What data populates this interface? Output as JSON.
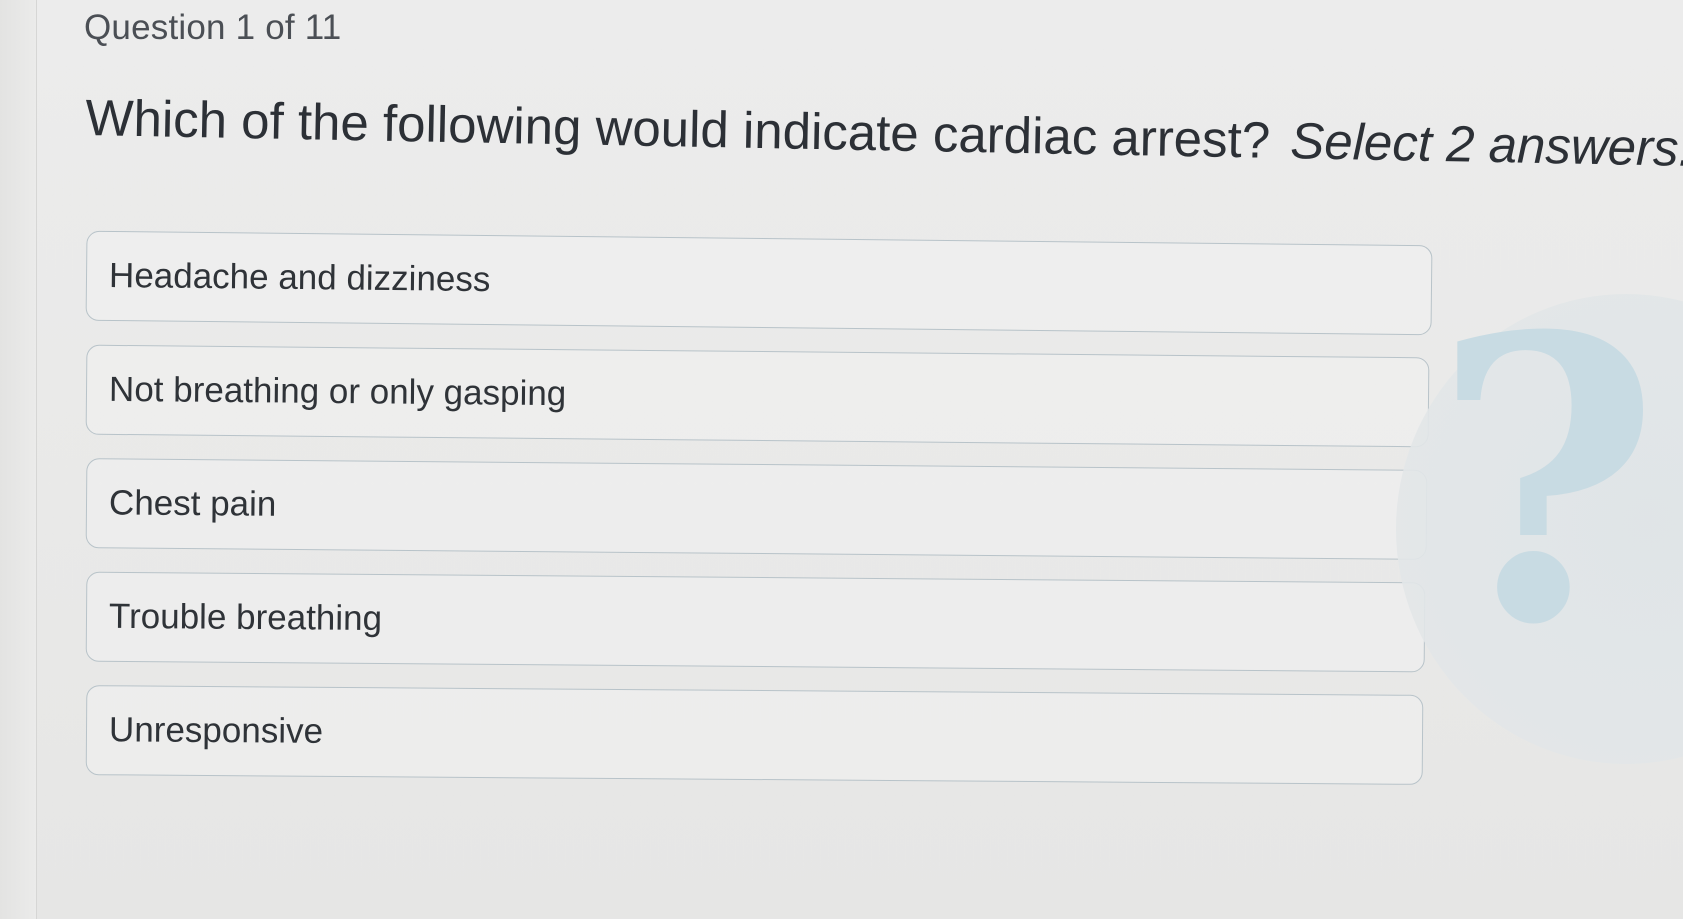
{
  "header": {
    "counter": "Question 1 of 11"
  },
  "question": {
    "text": "Which of the following would indicate cardiac arrest?",
    "instruction": "Select 2 answers."
  },
  "answers": [
    {
      "label": "Headache and dizziness"
    },
    {
      "label": "Not breathing or only gasping"
    },
    {
      "label": "Chest pain"
    },
    {
      "label": "Trouble breathing"
    },
    {
      "label": "Unresponsive"
    }
  ],
  "decoration": {
    "help_icon_char": "?",
    "help_icon_color": "#c8dbe3"
  }
}
